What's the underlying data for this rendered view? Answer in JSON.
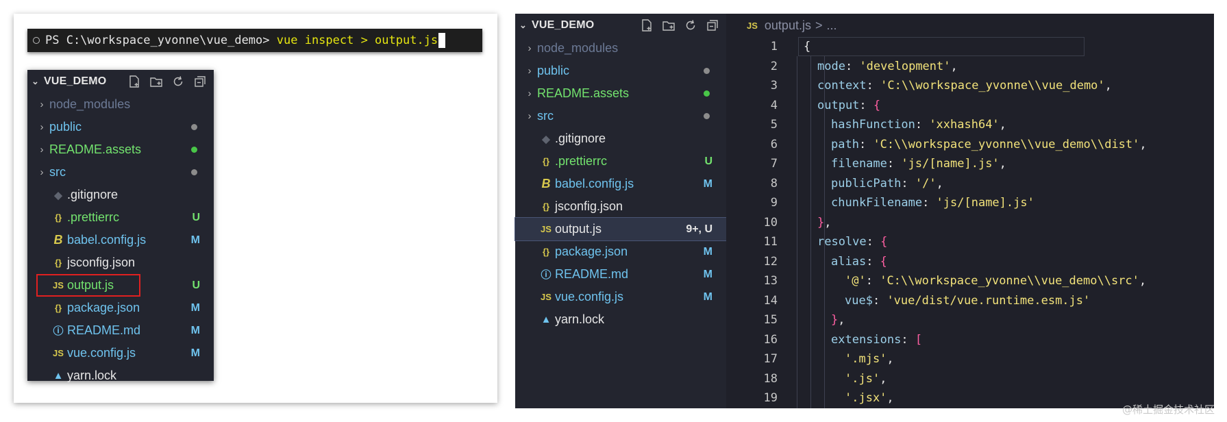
{
  "terminal": {
    "prompt": "PS C:\\workspace_yvonne\\vue_demo> ",
    "command": "vue inspect > output.js"
  },
  "explorer": {
    "title": "VUE_DEMO",
    "header_icons": [
      "new-file-icon",
      "new-folder-icon",
      "refresh-icon",
      "collapse-all-icon"
    ]
  },
  "left_files": [
    {
      "name": "node_modules",
      "kind": "folder",
      "icon": "",
      "color": "#6c7a96",
      "status": "",
      "status_type": "none"
    },
    {
      "name": "public",
      "kind": "folder",
      "icon": "",
      "color": "#6fc3ee",
      "status": "",
      "status_type": "dot",
      "dot_color": "#8c8c8c"
    },
    {
      "name": "README.assets",
      "kind": "folder",
      "icon": "",
      "color": "#73e36e",
      "status": "",
      "status_type": "dot",
      "dot_color": "#49c648"
    },
    {
      "name": "src",
      "kind": "folder",
      "icon": "",
      "color": "#6fc3ee",
      "status": "",
      "status_type": "dot",
      "dot_color": "#8c8c8c"
    },
    {
      "name": ".gitignore",
      "kind": "file",
      "icon": "◆",
      "icon_color": "#5f6470",
      "color": "#e6e6e6",
      "status": "",
      "status_type": "none"
    },
    {
      "name": ".prettierrc",
      "kind": "file",
      "icon": "{}",
      "icon_color": "#d8c94d",
      "color": "#73e36e",
      "status": "U",
      "status_type": "text",
      "status_color": "#73e36e"
    },
    {
      "name": "babel.config.js",
      "kind": "file",
      "icon": "B",
      "icon_color": "#d8c94d",
      "color": "#6fc3ee",
      "status": "M",
      "status_type": "text",
      "status_color": "#6fc3ee"
    },
    {
      "name": "jsconfig.json",
      "kind": "file",
      "icon": "{}",
      "icon_color": "#d8c94d",
      "color": "#e6e6e6",
      "status": "",
      "status_type": "none"
    },
    {
      "name": "output.js",
      "kind": "file",
      "icon": "JS",
      "icon_color": "#d8c94d",
      "color": "#73e36e",
      "status": "U",
      "status_type": "text",
      "status_color": "#73e36e"
    },
    {
      "name": "package.json",
      "kind": "file",
      "icon": "{}",
      "icon_color": "#d8c94d",
      "color": "#6fc3ee",
      "status": "M",
      "status_type": "text",
      "status_color": "#6fc3ee"
    },
    {
      "name": "README.md",
      "kind": "file",
      "icon": "ⓘ",
      "icon_color": "#6fc3ee",
      "color": "#6fc3ee",
      "status": "M",
      "status_type": "text",
      "status_color": "#6fc3ee"
    },
    {
      "name": "vue.config.js",
      "kind": "file",
      "icon": "JS",
      "icon_color": "#d8c94d",
      "color": "#6fc3ee",
      "status": "M",
      "status_type": "text",
      "status_color": "#6fc3ee"
    },
    {
      "name": "yarn.lock",
      "kind": "file",
      "icon": "▲",
      "icon_color": "#6fc3ee",
      "color": "#e6e6e6",
      "status": "",
      "status_type": "none"
    }
  ],
  "right_files": [
    {
      "name": "node_modules",
      "kind": "folder",
      "icon": "",
      "color": "#6c7a96",
      "status": "",
      "status_type": "none"
    },
    {
      "name": "public",
      "kind": "folder",
      "icon": "",
      "color": "#6fc3ee",
      "status": "",
      "status_type": "dot",
      "dot_color": "#8c8c8c"
    },
    {
      "name": "README.assets",
      "kind": "folder",
      "icon": "",
      "color": "#73e36e",
      "status": "",
      "status_type": "dot",
      "dot_color": "#49c648"
    },
    {
      "name": "src",
      "kind": "folder",
      "icon": "",
      "color": "#6fc3ee",
      "status": "",
      "status_type": "dot",
      "dot_color": "#8c8c8c"
    },
    {
      "name": ".gitignore",
      "kind": "file",
      "icon": "◆",
      "icon_color": "#5f6470",
      "color": "#e6e6e6",
      "status": "",
      "status_type": "none"
    },
    {
      "name": ".prettierrc",
      "kind": "file",
      "icon": "{}",
      "icon_color": "#d8c94d",
      "color": "#73e36e",
      "status": "U",
      "status_type": "text",
      "status_color": "#73e36e"
    },
    {
      "name": "babel.config.js",
      "kind": "file",
      "icon": "B",
      "icon_color": "#d8c94d",
      "color": "#6fc3ee",
      "status": "M",
      "status_type": "text",
      "status_color": "#6fc3ee"
    },
    {
      "name": "jsconfig.json",
      "kind": "file",
      "icon": "{}",
      "icon_color": "#d8c94d",
      "color": "#e6e6e6",
      "status": "",
      "status_type": "none"
    },
    {
      "name": "output.js",
      "kind": "file",
      "icon": "JS",
      "icon_color": "#d8c94d",
      "color": "#e6e6e6",
      "status": "9+, U",
      "status_type": "text",
      "status_color": "#e6e6e6",
      "selected": true
    },
    {
      "name": "package.json",
      "kind": "file",
      "icon": "{}",
      "icon_color": "#d8c94d",
      "color": "#6fc3ee",
      "status": "M",
      "status_type": "text",
      "status_color": "#6fc3ee"
    },
    {
      "name": "README.md",
      "kind": "file",
      "icon": "ⓘ",
      "icon_color": "#6fc3ee",
      "color": "#6fc3ee",
      "status": "M",
      "status_type": "text",
      "status_color": "#6fc3ee"
    },
    {
      "name": "vue.config.js",
      "kind": "file",
      "icon": "JS",
      "icon_color": "#d8c94d",
      "color": "#6fc3ee",
      "status": "M",
      "status_type": "text",
      "status_color": "#6fc3ee"
    },
    {
      "name": "yarn.lock",
      "kind": "file",
      "icon": "▲",
      "icon_color": "#6fc3ee",
      "color": "#e6e6e6",
      "status": "",
      "status_type": "none"
    }
  ],
  "editor": {
    "breadcrumb_icon": "JS",
    "breadcrumb_file": "output.js",
    "breadcrumb_sep": ">",
    "breadcrumb_more": "...",
    "lines": [
      {
        "n": "1",
        "indent": 0,
        "parts": [
          [
            "p",
            "{"
          ]
        ]
      },
      {
        "n": "2",
        "indent": 1,
        "parts": [
          [
            "k",
            "mode"
          ],
          [
            "p",
            ": "
          ],
          [
            "s",
            "'development'"
          ],
          [
            "p",
            ","
          ]
        ]
      },
      {
        "n": "3",
        "indent": 1,
        "parts": [
          [
            "k",
            "context"
          ],
          [
            "p",
            ": "
          ],
          [
            "s",
            "'C:\\\\workspace_yvonne\\\\vue_demo'"
          ],
          [
            "p",
            ","
          ]
        ]
      },
      {
        "n": "4",
        "indent": 1,
        "parts": [
          [
            "k",
            "output"
          ],
          [
            "p",
            ": "
          ],
          [
            "pink",
            "{"
          ]
        ]
      },
      {
        "n": "5",
        "indent": 2,
        "parts": [
          [
            "k",
            "hashFunction"
          ],
          [
            "p",
            ": "
          ],
          [
            "s",
            "'xxhash64'"
          ],
          [
            "p",
            ","
          ]
        ]
      },
      {
        "n": "6",
        "indent": 2,
        "parts": [
          [
            "k",
            "path"
          ],
          [
            "p",
            ": "
          ],
          [
            "s",
            "'C:\\\\workspace_yvonne\\\\vue_demo\\\\dist'"
          ],
          [
            "p",
            ","
          ]
        ]
      },
      {
        "n": "7",
        "indent": 2,
        "parts": [
          [
            "k",
            "filename"
          ],
          [
            "p",
            ": "
          ],
          [
            "s",
            "'js/[name].js'"
          ],
          [
            "p",
            ","
          ]
        ]
      },
      {
        "n": "8",
        "indent": 2,
        "parts": [
          [
            "k",
            "publicPath"
          ],
          [
            "p",
            ": "
          ],
          [
            "s",
            "'/'"
          ],
          [
            "p",
            ","
          ]
        ]
      },
      {
        "n": "9",
        "indent": 2,
        "parts": [
          [
            "k",
            "chunkFilename"
          ],
          [
            "p",
            ": "
          ],
          [
            "s",
            "'js/[name].js'"
          ]
        ]
      },
      {
        "n": "10",
        "indent": 1,
        "parts": [
          [
            "pink",
            "}"
          ],
          [
            "p",
            ","
          ]
        ]
      },
      {
        "n": "11",
        "indent": 1,
        "parts": [
          [
            "k",
            "resolve"
          ],
          [
            "p",
            ": "
          ],
          [
            "pink",
            "{"
          ]
        ]
      },
      {
        "n": "12",
        "indent": 2,
        "parts": [
          [
            "k",
            "alias"
          ],
          [
            "p",
            ": "
          ],
          [
            "pink",
            "{"
          ]
        ]
      },
      {
        "n": "13",
        "indent": 3,
        "parts": [
          [
            "s",
            "'@'"
          ],
          [
            "p",
            ": "
          ],
          [
            "s",
            "'C:\\\\workspace_yvonne\\\\vue_demo\\\\src'"
          ],
          [
            "p",
            ","
          ]
        ]
      },
      {
        "n": "14",
        "indent": 3,
        "parts": [
          [
            "k",
            "vue$"
          ],
          [
            "p",
            ": "
          ],
          [
            "s",
            "'vue/dist/vue.runtime.esm.js'"
          ]
        ]
      },
      {
        "n": "15",
        "indent": 2,
        "parts": [
          [
            "pink",
            "}"
          ],
          [
            "p",
            ","
          ]
        ]
      },
      {
        "n": "16",
        "indent": 2,
        "parts": [
          [
            "k",
            "extensions"
          ],
          [
            "p",
            ": "
          ],
          [
            "pink",
            "["
          ]
        ]
      },
      {
        "n": "17",
        "indent": 3,
        "parts": [
          [
            "s",
            "'.mjs'"
          ],
          [
            "p",
            ","
          ]
        ]
      },
      {
        "n": "18",
        "indent": 3,
        "parts": [
          [
            "s",
            "'.js'"
          ],
          [
            "p",
            ","
          ]
        ]
      },
      {
        "n": "19",
        "indent": 3,
        "parts": [
          [
            "s",
            "'.jsx'"
          ],
          [
            "p",
            ","
          ]
        ]
      }
    ]
  },
  "watermark": "@稀土掘金技术社区"
}
